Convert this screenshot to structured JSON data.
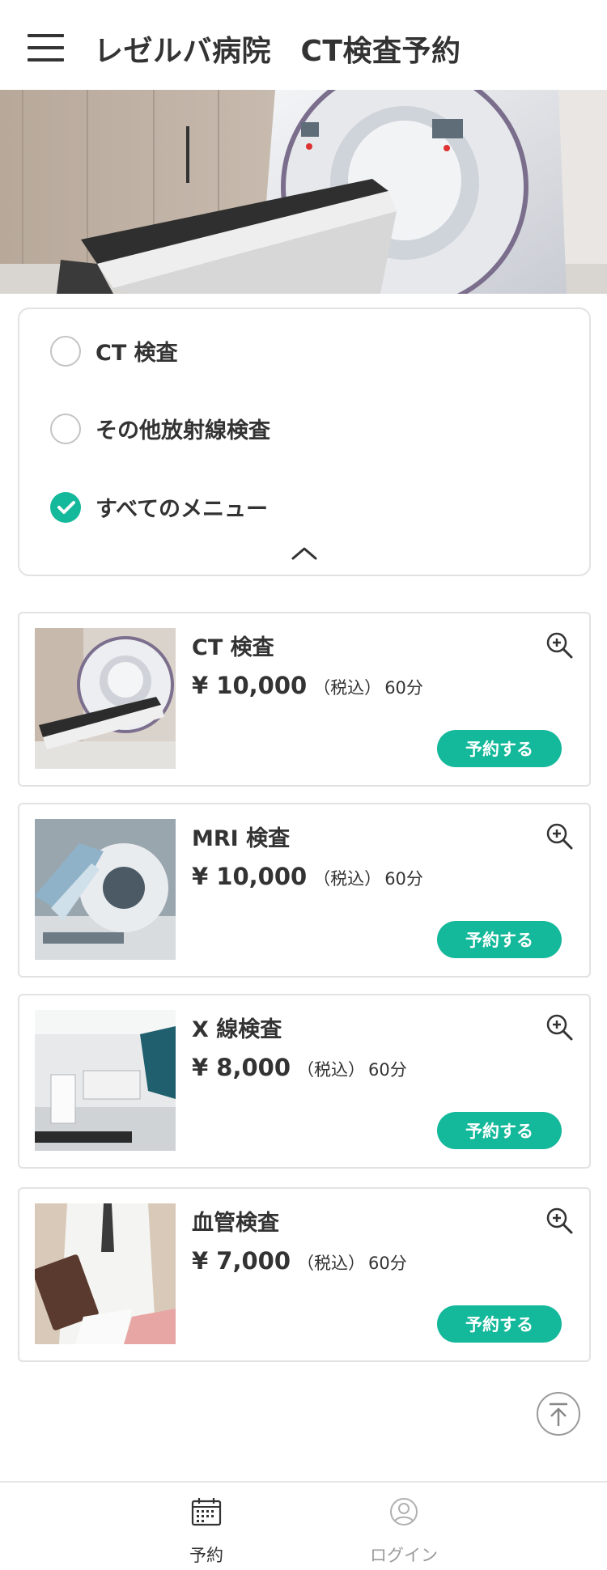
{
  "header": {
    "title": "レゼルバ病院　CT検査予約",
    "menu_icon": "hamburger-menu-icon"
  },
  "filter": {
    "options": [
      {
        "label": "CT 検査",
        "checked": false
      },
      {
        "label": "その他放射線検査",
        "checked": false
      },
      {
        "label": "すべてのメニュー",
        "checked": true
      }
    ],
    "collapse_icon": "chevron-up-icon"
  },
  "exams": [
    {
      "name": "CT 検査",
      "price": "¥ 10,000",
      "tax": "（税込）",
      "duration": "60分",
      "reserve_label": "予約する"
    },
    {
      "name": "MRI 検査",
      "price": "¥ 10,000",
      "tax": "（税込）",
      "duration": "60分",
      "reserve_label": "予約する"
    },
    {
      "name": "X 線検査",
      "price": "¥ 8,000",
      "tax": "（税込）",
      "duration": "60分",
      "reserve_label": "予約する"
    },
    {
      "name": "血管検査",
      "price": "¥ 7,000",
      "tax": "（税込）",
      "duration": "60分",
      "reserve_label": "予約する"
    }
  ],
  "bottom_nav": {
    "reserve": {
      "label": "予約",
      "icon": "calendar-icon"
    },
    "login": {
      "label": "ログイン",
      "icon": "user-icon"
    }
  },
  "colors": {
    "accent": "#14b89a",
    "text": "#333333",
    "border": "#e2e2e2",
    "inactive": "#9a9a9a"
  }
}
